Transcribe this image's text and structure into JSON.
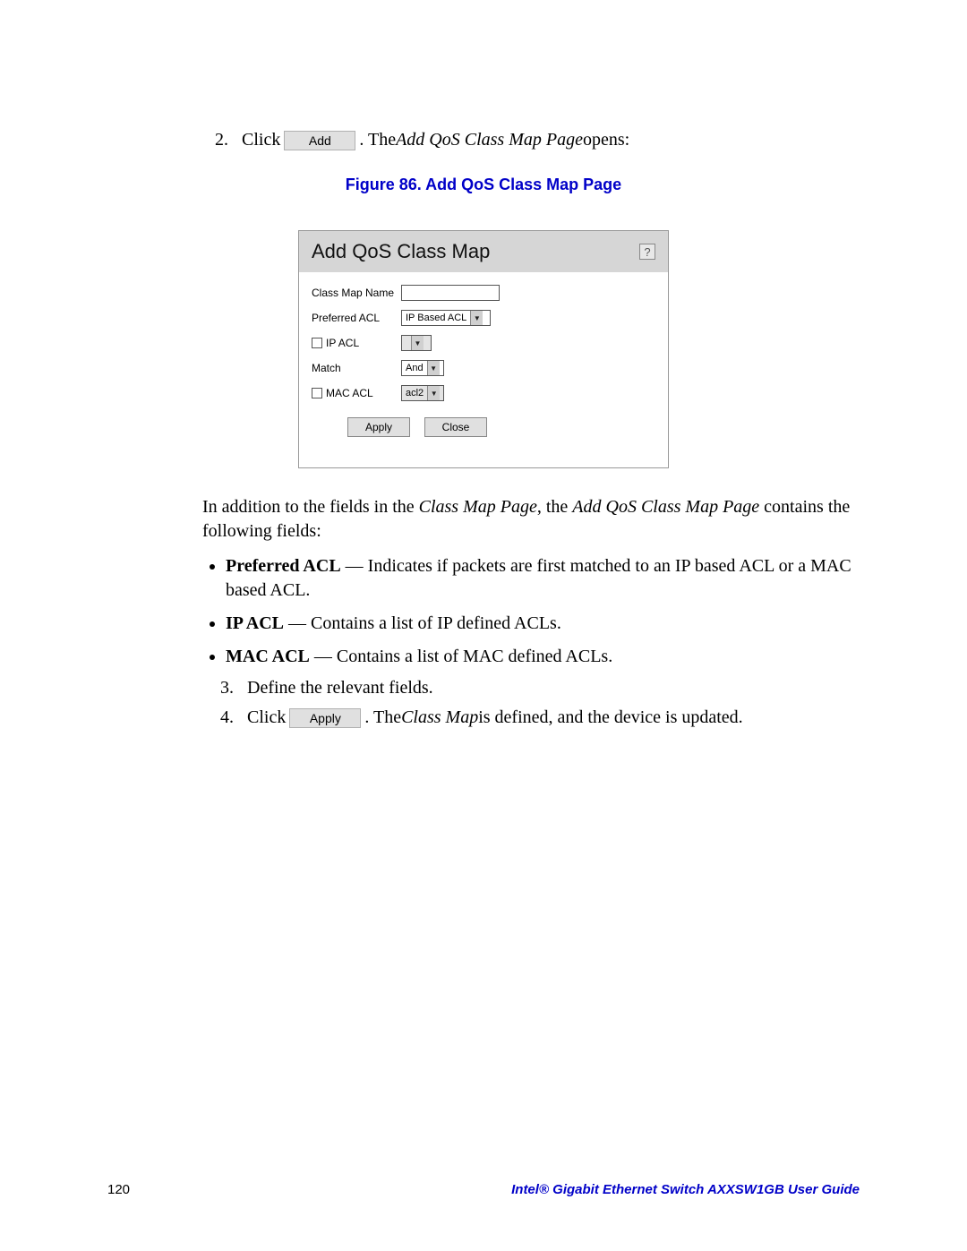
{
  "step2": {
    "num": "2.",
    "click": "Click",
    "btn": "Add",
    "after1": ". The ",
    "italic": "Add QoS Class Map Page",
    "after2": " opens:"
  },
  "figure_caption": "Figure 86. Add QoS Class Map Page",
  "dialog": {
    "title": "Add QoS Class Map",
    "help": "?",
    "rows": {
      "classmap": {
        "label": "Class Map Name"
      },
      "preferred": {
        "label": "Preferred ACL",
        "value": "IP Based ACL"
      },
      "ipacl": {
        "label": "IP ACL"
      },
      "match": {
        "label": "Match",
        "value": "And"
      },
      "macacl": {
        "label": "MAC ACL",
        "value": "acl2"
      }
    },
    "buttons": {
      "apply": "Apply",
      "close": "Close"
    }
  },
  "intro": {
    "p1": "In addition to the fields in the ",
    "i1": "Class Map Page",
    "p2": ", the ",
    "i2": "Add QoS Class Map Page",
    "p3": " contains the following fields:"
  },
  "bullets": [
    {
      "b": "Preferred ACL",
      "t": " — Indicates if packets are first matched to an IP based ACL or a MAC based ACL."
    },
    {
      "b": "IP ACL",
      "t": " — Contains a list of IP defined ACLs."
    },
    {
      "b": "MAC ACL",
      "t": " — Contains a list of MAC defined ACLs."
    }
  ],
  "step3": {
    "num": "3.",
    "text": "Define the relevant fields."
  },
  "step4": {
    "num": "4.",
    "click": "Click",
    "btn": "Apply",
    "after1": ". The ",
    "italic": "Class Map",
    "after2": " is defined, and the device is updated."
  },
  "footer": {
    "page": "120",
    "guide": "Intel® Gigabit Ethernet Switch AXXSW1GB User Guide"
  }
}
